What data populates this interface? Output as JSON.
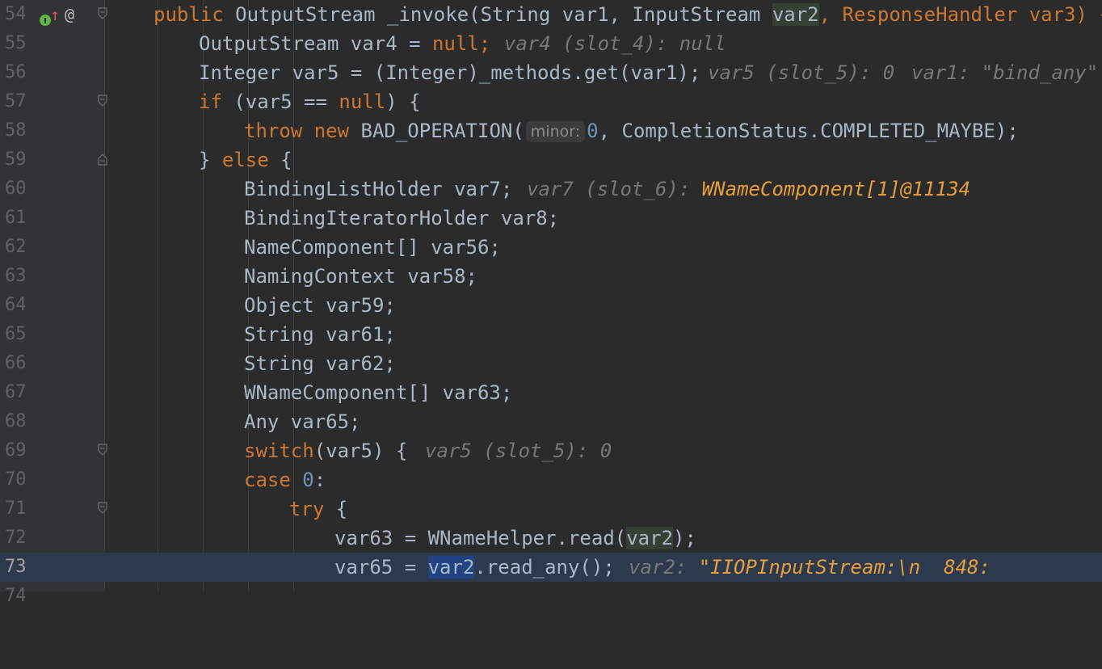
{
  "editor": {
    "line_numbers": [
      "54",
      "55",
      "56",
      "57",
      "58",
      "59",
      "60",
      "61",
      "62",
      "63",
      "64",
      "65",
      "66",
      "67",
      "68",
      "69",
      "70",
      "71",
      "72",
      "73",
      "74"
    ],
    "gutter_icons": {
      "override_badge": "I",
      "up_arrow": "↑",
      "at_sign": "@"
    },
    "lines": {
      "l54": {
        "a": "public ",
        "b": "OutputStream _invoke(String var1, InputStream ",
        "c": "var2",
        "d": ", ResponseHandler var3) {"
      },
      "l55": {
        "a": "OutputStream var4 = ",
        "b": "null",
        "c": ";",
        "hint_prefix": "var4 (slot_4): ",
        "hint_value": "null"
      },
      "l56": {
        "a": "Integer var5 = (Integer)_methods.get(var1);",
        "hint1": "var5 (slot_5): 0",
        "hint2_prefix": "var1: ",
        "hint2_value": "\"bind_any\""
      },
      "l57": {
        "a": "if ",
        "b": "(var5 == ",
        "c": "null",
        "d": ") {"
      },
      "l58": {
        "a": "throw new ",
        "b": "BAD_OPERATION(",
        "chip": "minor:",
        "c": "0",
        "d": ", CompletionStatus.COMPLETED_MAYBE);"
      },
      "l59": {
        "a": "} ",
        "b": "else ",
        "c": "{"
      },
      "l60": {
        "a": "BindingListHolder var7;",
        "hint_prefix": "var7 (slot_6): ",
        "hint_value": "WNameComponent[1]@11134"
      },
      "l61": {
        "a": "BindingIteratorHolder var8;"
      },
      "l62": {
        "a": "NameComponent[] var56;"
      },
      "l63": {
        "a": "NamingContext var58;"
      },
      "l64": {
        "a": "Object var59;"
      },
      "l65": {
        "a": "String var61;"
      },
      "l66": {
        "a": "String var62;"
      },
      "l67": {
        "a": "WNameComponent[] var63;"
      },
      "l68": {
        "a": "Any var65;"
      },
      "l69": {
        "a": "switch",
        "b": "(var5) {",
        "hint": "var5 (slot_5): 0"
      },
      "l70": {
        "a": "case ",
        "b": "0",
        "c": ":"
      },
      "l71": {
        "a": "try ",
        "b": "{"
      },
      "l72": {
        "a": "var63 = WNameHelper.read(",
        "b": "var2",
        "c": ");"
      },
      "l73": {
        "a": "var65 = ",
        "b": "var2",
        "c": ".read_any();",
        "hint_prefix": "var2: ",
        "hint_value": "\"IIOPInputStream:\\n  848:"
      }
    }
  },
  "colors": {
    "background": "#2b2b2b",
    "keyword": "#cc7832",
    "plain": "#a9b7c6",
    "number": "#6897bb",
    "string": "#6a8759",
    "current_line": "#2d3a4e"
  }
}
